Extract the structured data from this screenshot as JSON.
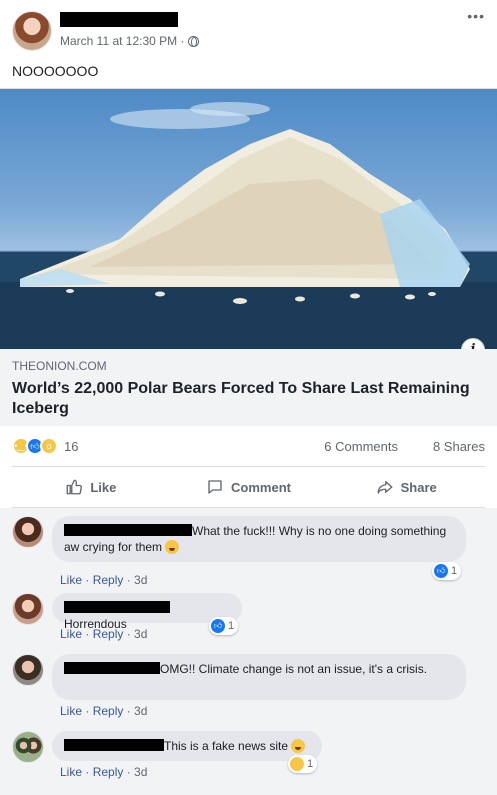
{
  "post": {
    "timestamp": "March 11 at 12:30 PM · ",
    "text": "NOOOOOOO",
    "more_icon": "more-horizontal-icon",
    "privacy_icon": "globe-icon"
  },
  "link": {
    "domain": "THEONION.COM",
    "title": "World’s 22,000 Polar Bears Forced To Share Last Remaining Iceberg",
    "info_label": "i"
  },
  "reactions": {
    "icons": [
      "sad-reaction-icon",
      "like-reaction-icon",
      "wow-reaction-icon"
    ],
    "count": "16",
    "comments": "6 Comments",
    "shares": "8 Shares"
  },
  "actions": {
    "like": "Like",
    "comment": "Comment",
    "share": "Share"
  },
  "comments": [
    {
      "text": "What the fuck!!! Why is no one doing something aw crying for them",
      "emoji": "crying-face-icon",
      "like": "Like",
      "reply": "Reply",
      "age": "3d",
      "reaction_count": "1"
    },
    {
      "text": "Horrendous",
      "like": "Like",
      "reply": "Reply",
      "age": "3d",
      "reaction_count": "1"
    },
    {
      "text": "OMG!! Climate change is not an issue, it's a crisis.",
      "like": "Like",
      "reply": "Reply",
      "age": "3d"
    },
    {
      "text": "This is a fake news site",
      "emoji": "laughing-face-icon",
      "like": "Like",
      "reply": "Reply",
      "age": "3d",
      "reaction_count": "1"
    }
  ],
  "colors": {
    "link_blue": "#385898",
    "like_blue": "#1877f2",
    "bubble_gray": "#e4e6eb",
    "meta_gray": "#606770"
  }
}
